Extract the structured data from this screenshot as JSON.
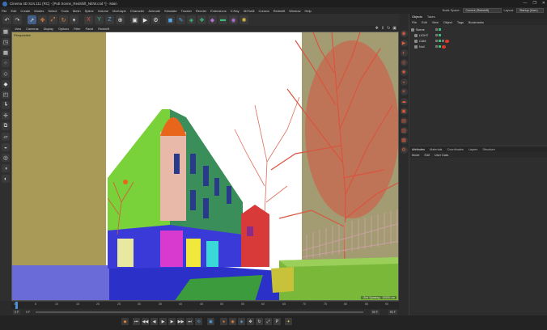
{
  "titlebar": {
    "title": "Cinema 4D S24.111 (RC) - [Pub Scene_Redshift_NEW.c4d *] - Main",
    "controls": [
      "—",
      "❐",
      "✕"
    ]
  },
  "menubar": {
    "items": [
      "File",
      "Edit",
      "Create",
      "Modes",
      "Select",
      "Tools",
      "Mesh",
      "Spline",
      "Volume",
      "MoGraph",
      "Character",
      "Animate",
      "Simulate",
      "Tracker",
      "Render",
      "Extensions",
      "V-Ray",
      "3DToAll",
      "Corona",
      "Redshift",
      "Window",
      "Help"
    ],
    "node_space_label": "Node Space:",
    "node_space_value": "Current (Redshift)",
    "layout_label": "Layout:",
    "layout_value": "Startup (User)"
  },
  "toolbar": {
    "icons": [
      "undo-icon",
      "redo-icon",
      "select-icon",
      "move-icon",
      "scale-icon",
      "rotate-icon",
      "recent-tool-icon",
      "x-axis-icon",
      "y-axis-icon",
      "z-axis-icon",
      "coord-system-icon",
      "render-region-icon",
      "render-view-icon",
      "render-settings-icon",
      "cube-icon",
      "pen-icon",
      "subdivision-icon",
      "cloner-icon",
      "deformer-icon",
      "floor-icon",
      "camera-icon",
      "light-icon"
    ]
  },
  "viewport": {
    "menu": [
      "View",
      "Cameras",
      "Display",
      "Options",
      "Filter",
      "Panel",
      "Redshift"
    ],
    "label": "Perspective",
    "grid_spacing": "Grid Spacing : 10000 cm"
  },
  "timeline": {
    "ticks": [
      "0",
      "5",
      "10",
      "15",
      "20",
      "25",
      "30",
      "35",
      "40",
      "45",
      "50",
      "55",
      "60",
      "65",
      "70",
      "75",
      "80",
      "85",
      "90"
    ],
    "frame_start": "0 F",
    "frame_current": "0 F",
    "frame_end": "90 F",
    "frame_end2": "90 F"
  },
  "objects_panel": {
    "tabs": [
      "Objects",
      "Takes"
    ],
    "menu": [
      "File",
      "Edit",
      "View",
      "Object",
      "Tags",
      "Bookmarks"
    ],
    "rows": [
      {
        "name": "Scene",
        "indent": 0
      },
      {
        "name": "LIGHT",
        "indent": 1
      },
      {
        "name": "CAM",
        "indent": 1
      },
      {
        "name": "Null",
        "indent": 1
      }
    ]
  },
  "attributes_panel": {
    "tabs": [
      "Attributes",
      "Materials",
      "Coordinates",
      "Layers",
      "Structure"
    ],
    "menu": [
      "Mode",
      "Edit",
      "User Data"
    ]
  },
  "colors": {
    "accent": "#4a90d9",
    "tag_red": "#d83a2a",
    "building_orange": "#e8661c",
    "tree_red": "#d9543f"
  }
}
